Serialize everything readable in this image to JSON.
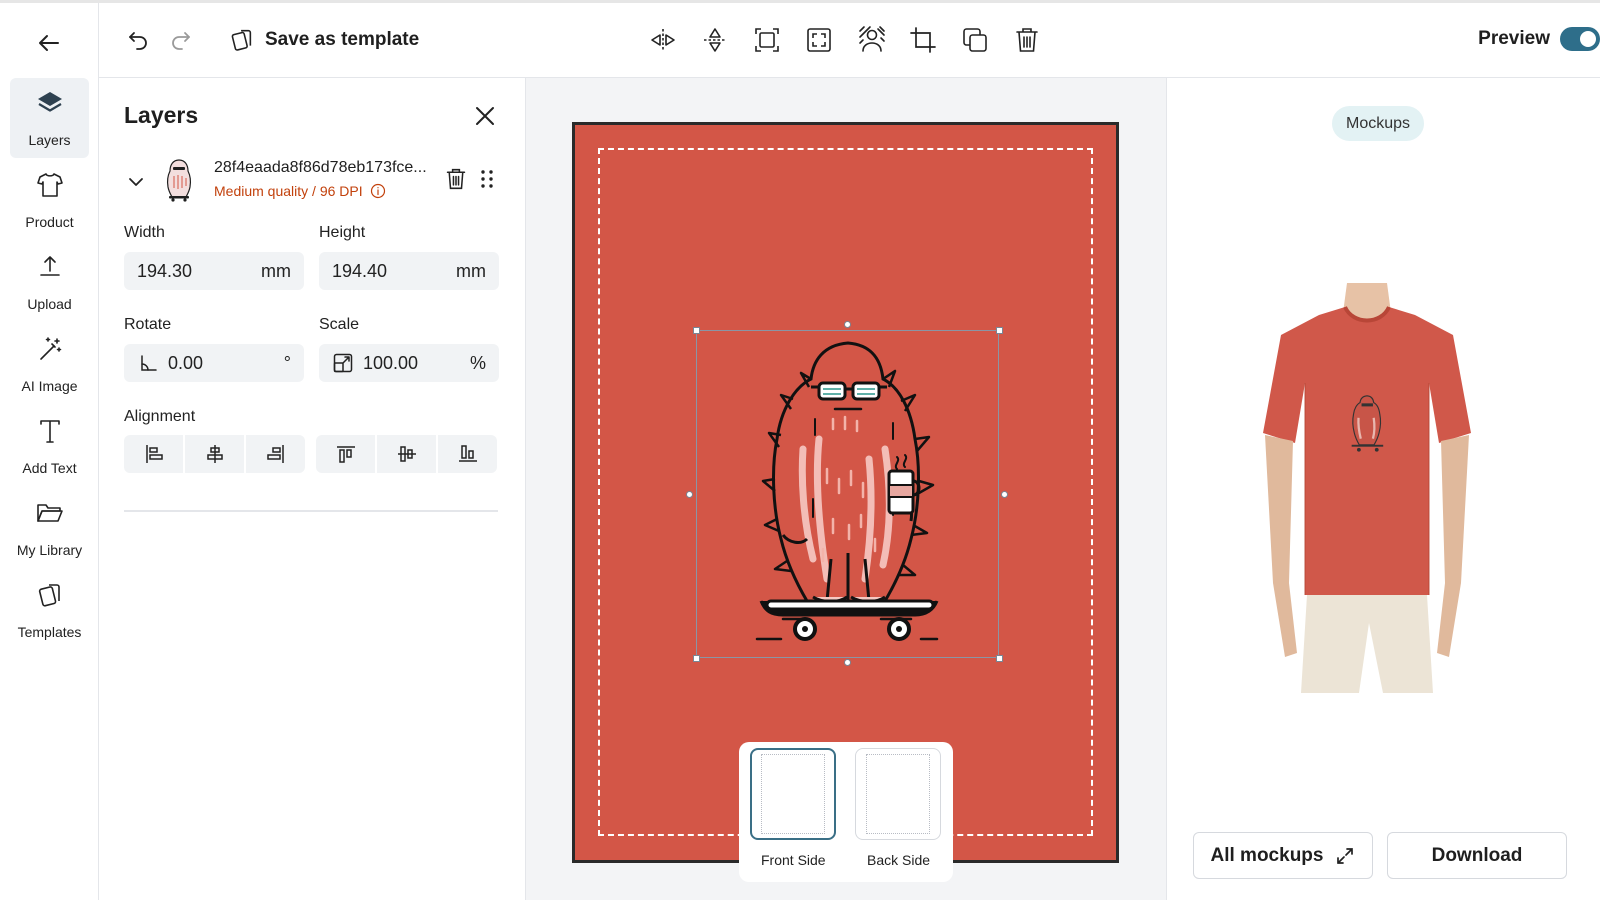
{
  "rail": {
    "items": [
      {
        "label": "Layers",
        "icon": "layers-icon",
        "active": true
      },
      {
        "label": "Product",
        "icon": "tshirt-icon"
      },
      {
        "label": "Upload",
        "icon": "upload-icon"
      },
      {
        "label": "AI Image",
        "icon": "magic-wand-icon"
      },
      {
        "label": "Add Text",
        "icon": "text-icon"
      },
      {
        "label": "My Library",
        "icon": "folder-icon"
      },
      {
        "label": "Templates",
        "icon": "templates-icon"
      }
    ]
  },
  "toolbar": {
    "save_template_label": "Save as template",
    "preview_label": "Preview",
    "preview_on": true,
    "tools": [
      "flip-horizontal-icon",
      "flip-vertical-icon",
      "fit-icon",
      "fill-icon",
      "remove-background-icon",
      "crop-icon",
      "duplicate-icon",
      "trash-icon"
    ]
  },
  "layers_panel": {
    "title": "Layers",
    "layer": {
      "name": "28f4eaada8f86d78eb173fce...",
      "quality": "Medium quality / 96 DPI"
    },
    "width": {
      "label": "Width",
      "value": "194.30",
      "unit": "mm"
    },
    "height": {
      "label": "Height",
      "value": "194.40",
      "unit": "mm"
    },
    "rotate": {
      "label": "Rotate",
      "value": "0.00",
      "unit": "°"
    },
    "scale": {
      "label": "Scale",
      "value": "100.00",
      "unit": "%"
    },
    "alignment_label": "Alignment"
  },
  "canvas": {
    "background_color": "#d35647",
    "sides": [
      {
        "label": "Front Side",
        "active": true
      },
      {
        "label": "Back Side",
        "active": false
      }
    ]
  },
  "mockups_panel": {
    "chip_label": "Mockups",
    "all_mockups_label": "All mockups",
    "download_label": "Download"
  },
  "colors": {
    "accent": "#2e6e8a",
    "quality_warning": "#c2410c",
    "shirt": "#d0584a"
  }
}
